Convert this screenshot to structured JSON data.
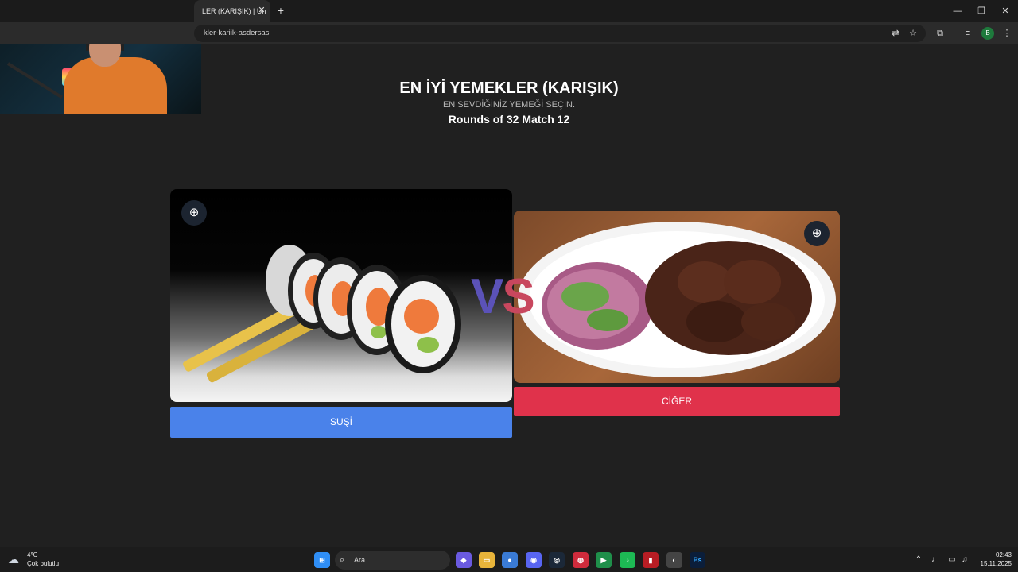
{
  "browser": {
    "tab_title": "LER (KARIŞIK) | Un",
    "tab_close": "✕",
    "new_tab": "+",
    "url": "kler-kariik-asdersas",
    "profile_initial": "B",
    "window_controls": {
      "minimize": "—",
      "restore": "❐",
      "close": "✕"
    }
  },
  "page": {
    "title": "EN İYİ YEMEKLER (KARIŞIK)",
    "subtitle": "EN SEVDİĞİNİZ YEMEĞİ SEÇİN.",
    "round": "Rounds of 32 Match 12",
    "vs_v": "V",
    "vs_s": "S"
  },
  "contestants": {
    "left": {
      "label": "SUŞİ",
      "color": "#4a82ea"
    },
    "right": {
      "label": "CİĞER",
      "color": "#e0324b"
    }
  },
  "taskbar": {
    "weather_temp": "4°C",
    "weather_desc": "Çok bulutlu",
    "search_placeholder": "Ara",
    "time": "02:43",
    "date": "15.11.2025"
  }
}
